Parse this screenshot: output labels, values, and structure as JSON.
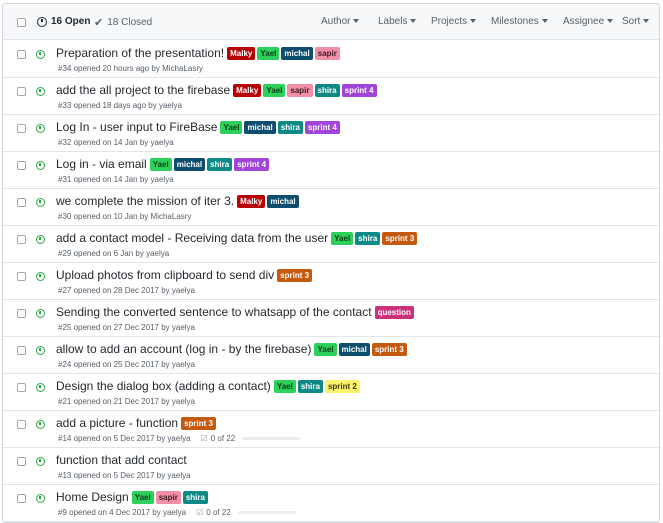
{
  "header": {
    "open_label": "16 Open",
    "closed_label": "18 Closed",
    "filters": [
      "Author",
      "Labels",
      "Projects",
      "Milestones",
      "Assignee",
      "Sort"
    ]
  },
  "label_colors": {
    "Malky": "#b60205",
    "Yael": "#2cd05b",
    "michal": "#0e4d6e",
    "sapir": "#f28fa8",
    "shira": "#0e8a86",
    "sprint 4": "#a145d8",
    "sprint 3": "#c55a0e",
    "sprint 2": "#fef26d",
    "question": "#cc317c"
  },
  "label_text_colors": {
    "Yael": "#0b3d16",
    "sapir": "#3b1a22",
    "sprint 2": "#3b3608"
  },
  "issues": [
    {
      "title": "Preparation of the presentation!",
      "labels": [
        "Malky",
        "Yael",
        "michal",
        "sapir"
      ],
      "meta": "#34 opened 20 hours ago by MichaLasry"
    },
    {
      "title": "add the all project to the firebase",
      "labels": [
        "Malky",
        "Yael",
        "sapir",
        "shira",
        "sprint 4"
      ],
      "meta": "#33 opened 18 days ago by yaelya"
    },
    {
      "title": "Log In - user input to FireBase",
      "labels": [
        "Yael",
        "michal",
        "shira",
        "sprint 4"
      ],
      "meta": "#32 opened on 14 Jan by yaelya"
    },
    {
      "title": "Log in - via email",
      "labels": [
        "Yael",
        "michal",
        "shira",
        "sprint 4"
      ],
      "meta": "#31 opened on 14 Jan by yaelya"
    },
    {
      "title": "we complete the mission of iter 3.",
      "labels": [
        "Malky",
        "michal"
      ],
      "meta": "#30 opened on 10 Jan by MichaLasry"
    },
    {
      "title": "add a contact model - Receiving data from the user",
      "labels": [
        "Yael",
        "shira",
        "sprint 3"
      ],
      "meta": "#29 opened on 6 Jan by yaelya"
    },
    {
      "title": "Upload photos from clipboard to send div",
      "labels": [
        "sprint 3"
      ],
      "meta": "#27 opened on 28 Dec 2017 by yaelya"
    },
    {
      "title": "Sending the converted sentence to whatsapp of the contact",
      "labels": [
        "question"
      ],
      "meta": "#25 opened on 27 Dec 2017 by yaelya"
    },
    {
      "title": "allow to add an account (log in - by the firebase)",
      "labels": [
        "Yael",
        "michal",
        "sprint 3"
      ],
      "meta": "#24 opened on 25 Dec 2017 by yaelya"
    },
    {
      "title": "Design the dialog box (adding a contact)",
      "labels": [
        "Yael",
        "shira",
        "sprint 2"
      ],
      "meta": "#21 opened on 21 Dec 2017 by yaelya"
    },
    {
      "title": "add a picture - function",
      "labels": [
        "sprint 3"
      ],
      "meta": "#14 opened on 5 Dec 2017 by yaelya",
      "tasks": "0 of 22",
      "task_progress": 0
    },
    {
      "title": "function that add contact",
      "labels": [],
      "meta": "#13 opened on 5 Dec 2017 by yaelya"
    },
    {
      "title": "Home Design",
      "labels": [
        "Yael",
        "sapir",
        "shira"
      ],
      "meta": "#9 opened on 4 Dec 2017 by yaelya",
      "tasks": "0 of 22",
      "task_progress": 0
    }
  ]
}
